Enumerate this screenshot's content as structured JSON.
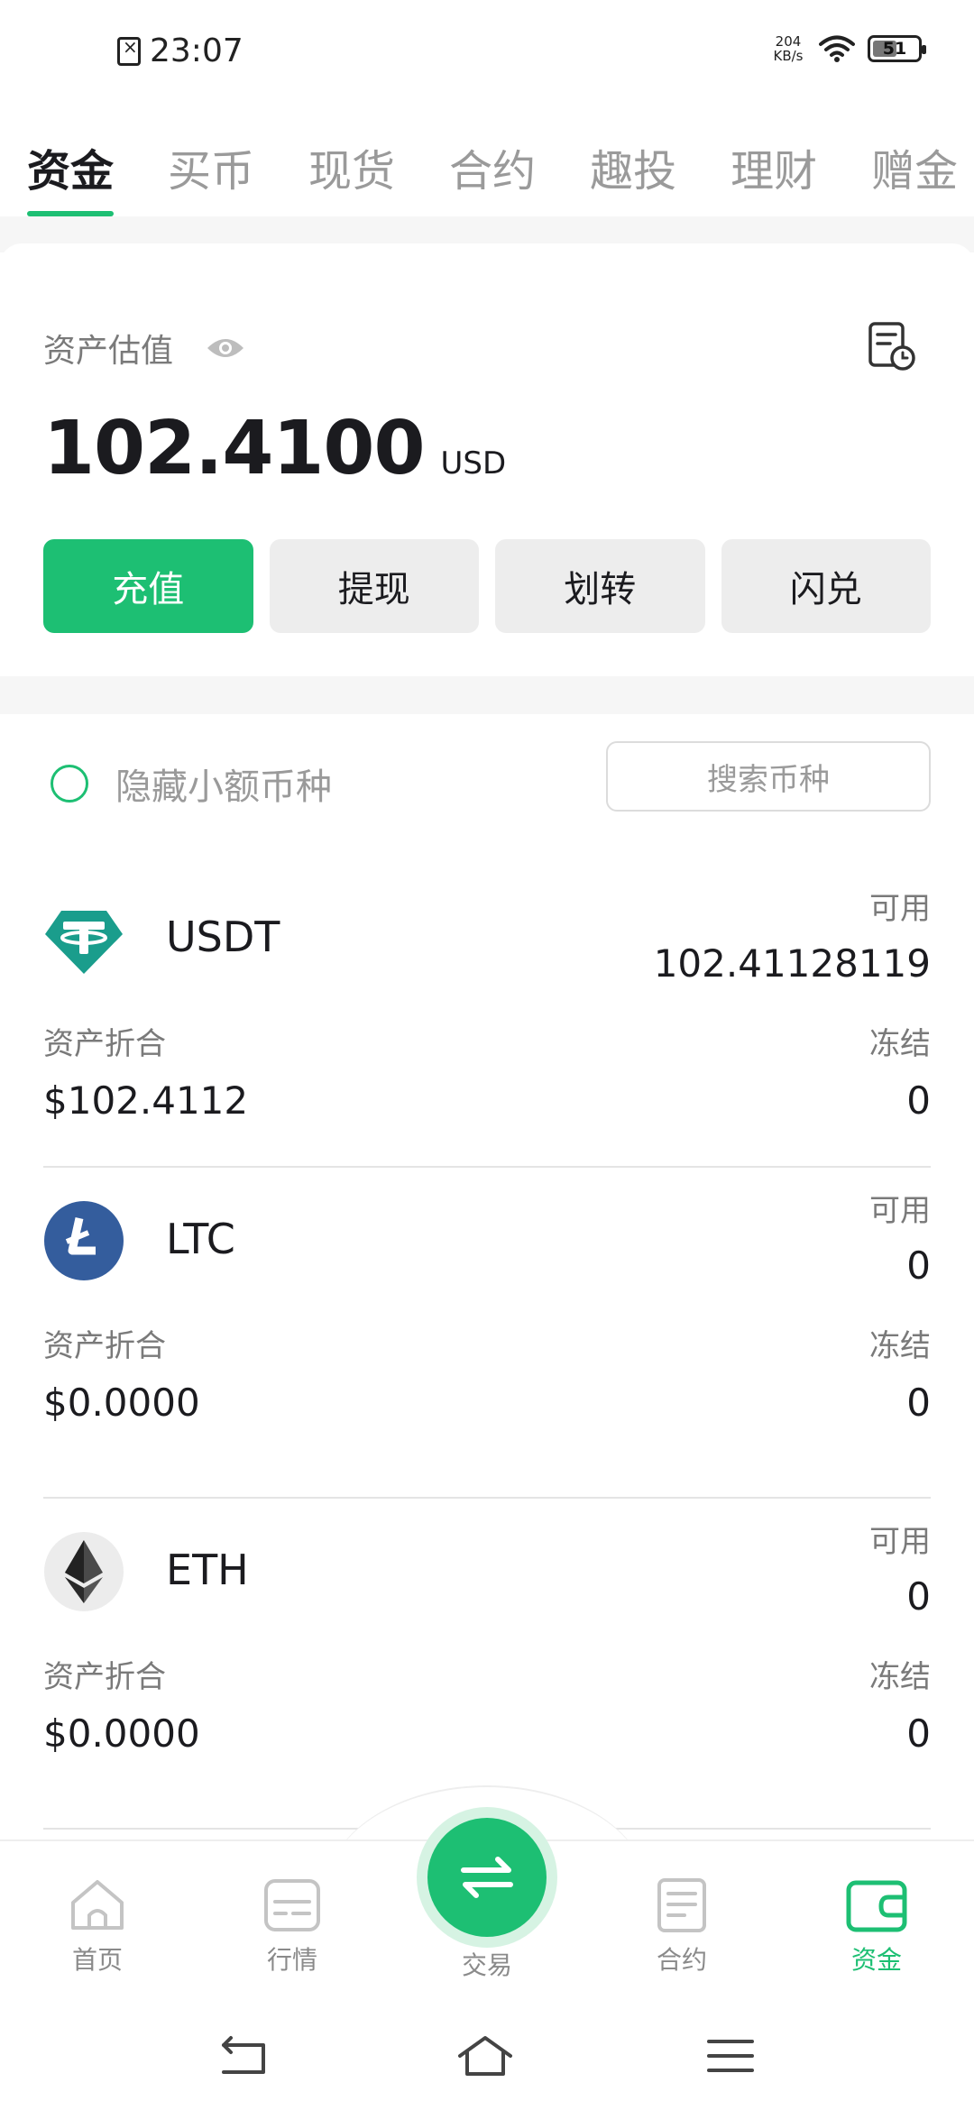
{
  "status_bar": {
    "time": "23:07",
    "net_speed_value": "204",
    "net_speed_unit": "KB/s",
    "battery": "51",
    "icons": [
      "sim-blocked-icon",
      "wifi-icon",
      "battery-icon"
    ]
  },
  "top_tabs": [
    {
      "label": "资金",
      "active": true
    },
    {
      "label": "买币",
      "active": false
    },
    {
      "label": "现货",
      "active": false
    },
    {
      "label": "合约",
      "active": false
    },
    {
      "label": "趣投",
      "active": false
    },
    {
      "label": "理财",
      "active": false
    },
    {
      "label": "赠金",
      "active": false
    }
  ],
  "asset": {
    "label": "资产估值",
    "value": "102.4100",
    "unit": "USD",
    "icons": [
      "eye-icon",
      "record-clock-icon"
    ]
  },
  "actions": {
    "deposit": "充值",
    "withdraw": "提现",
    "transfer": "划转",
    "swap": "闪兑"
  },
  "filter": {
    "hide_small_label": "隐藏小额币种",
    "search_placeholder": "搜索币种"
  },
  "coins": [
    {
      "name": "USDT",
      "available_label": "可用",
      "available": "102.41128119",
      "est_label": "资产折合",
      "est_value": "$102.4112",
      "frozen_label": "冻结",
      "frozen": "0",
      "logo": "tether-logo-icon"
    },
    {
      "name": "LTC",
      "available_label": "可用",
      "available": "0",
      "est_label": "资产折合",
      "est_value": "$0.0000",
      "frozen_label": "冻结",
      "frozen": "0",
      "logo": "litecoin-logo-icon"
    },
    {
      "name": "ETH",
      "available_label": "可用",
      "available": "0",
      "est_label": "资产折合",
      "est_value": "$0.0000",
      "frozen_label": "冻结",
      "frozen": "0",
      "logo": "ethereum-logo-icon"
    }
  ],
  "bottom_nav": {
    "home": "首页",
    "market": "行情",
    "trade": "交易",
    "contract": "合约",
    "funds": "资金",
    "active": "funds"
  },
  "colors": {
    "accent": "#1dbf73",
    "tether": "#1a9d8c",
    "litecoin": "#345d9d",
    "text_primary": "#1b1b1f",
    "text_secondary": "#7a7a7a"
  }
}
